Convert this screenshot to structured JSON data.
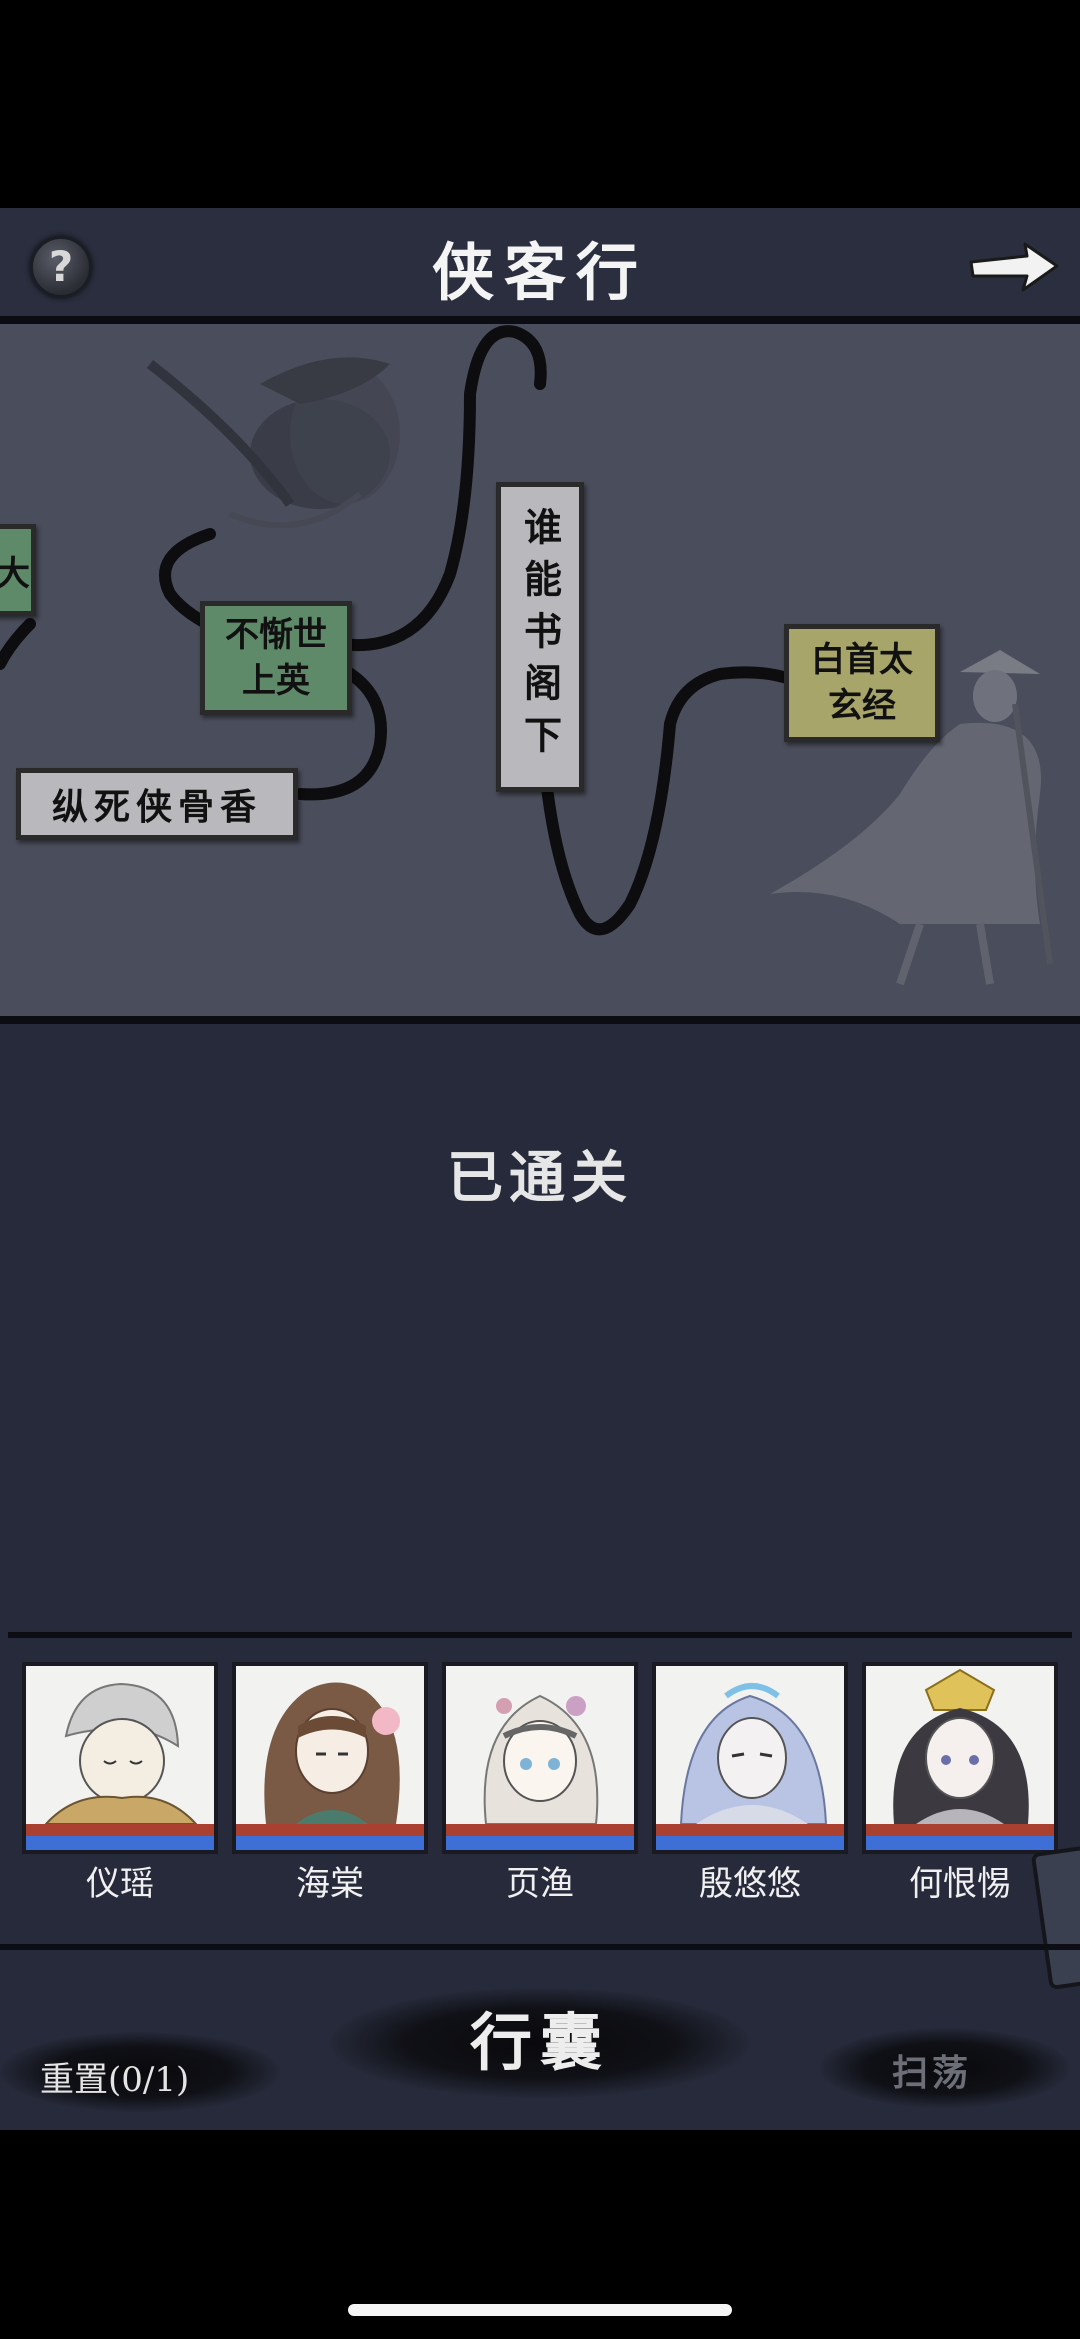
{
  "header": {
    "title": "侠客行",
    "help_icon": "?"
  },
  "map": {
    "nodes": [
      {
        "label": "大",
        "style": "green"
      },
      {
        "label": "不惭世上英",
        "style": "green"
      },
      {
        "label": "谁能书阁下",
        "style": "gray"
      },
      {
        "label": "白首太玄经",
        "style": "olive"
      },
      {
        "label": "纵死侠骨香",
        "style": "gray"
      }
    ]
  },
  "status": "已通关",
  "team": [
    {
      "name": "仪瑶"
    },
    {
      "name": "海棠"
    },
    {
      "name": "页渔"
    },
    {
      "name": "殷悠悠"
    },
    {
      "name": "何恨惕"
    }
  ],
  "bottom": {
    "reset_label": "重置(0/1)",
    "bag_label": "行囊",
    "sweep_label": "扫荡"
  },
  "colors": {
    "background": "#262a3a",
    "map_background": "#4a4d5b",
    "node_green": "#5f8a6a",
    "node_gray": "#b9b9bd",
    "node_olive": "#a8a56a",
    "hp_bar": "#a94030",
    "mp_bar": "#3d6fd6"
  }
}
